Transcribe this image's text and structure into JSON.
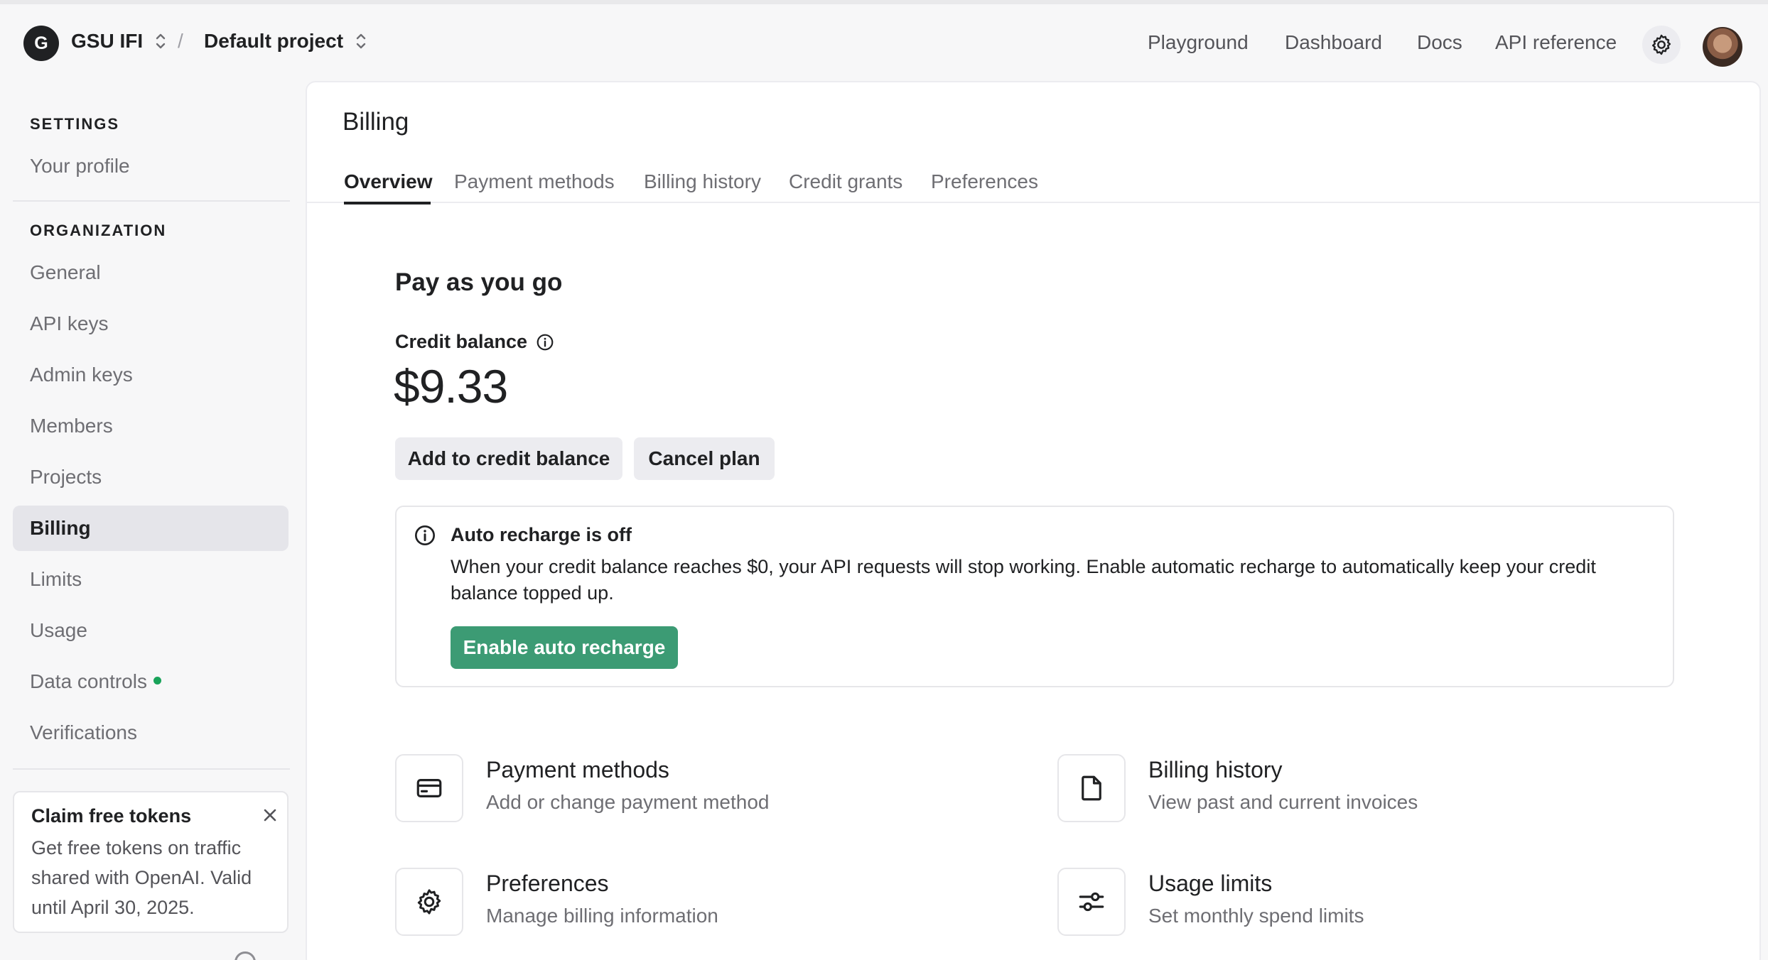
{
  "header": {
    "org_initial": "G",
    "org_name": "GSU IFI",
    "separator": "/",
    "project_name": "Default project",
    "nav": [
      "Playground",
      "Dashboard",
      "Docs",
      "API reference"
    ]
  },
  "sidebar": {
    "settings_heading": "SETTINGS",
    "settings_items": [
      "Your profile"
    ],
    "organization_heading": "ORGANIZATION",
    "org_items": [
      "General",
      "API keys",
      "Admin keys",
      "Members",
      "Projects",
      "Billing",
      "Limits",
      "Usage",
      "Data controls",
      "Verifications"
    ],
    "active_item": "Billing",
    "claim": {
      "title": "Claim free tokens",
      "body": "Get free tokens on traffic shared with OpenAI. Valid until April 30, 2025."
    }
  },
  "main": {
    "title": "Billing",
    "tabs": [
      "Overview",
      "Payment methods",
      "Billing history",
      "Credit grants",
      "Preferences"
    ],
    "active_tab": "Overview",
    "plan_title": "Pay as you go",
    "credit_label": "Credit balance",
    "credit_value": "$9.33",
    "add_credit_button": "Add to credit balance",
    "cancel_plan_button": "Cancel plan",
    "notice": {
      "title": "Auto recharge is off",
      "body": "When your credit balance reaches $0, your API requests will stop working. Enable automatic recharge to automatically keep your credit balance topped up.",
      "button": "Enable auto recharge"
    },
    "links": [
      {
        "title": "Payment methods",
        "subtitle": "Add or change payment method",
        "icon": "card-icon"
      },
      {
        "title": "Billing history",
        "subtitle": "View past and current invoices",
        "icon": "document-icon"
      },
      {
        "title": "Preferences",
        "subtitle": "Manage billing information",
        "icon": "gear-icon"
      },
      {
        "title": "Usage limits",
        "subtitle": "Set monthly spend limits",
        "icon": "sliders-icon"
      }
    ]
  },
  "colors": {
    "accent_green": "#3c9b74",
    "status_dot": "#19a35a",
    "active_bg": "#e5e5ea"
  }
}
